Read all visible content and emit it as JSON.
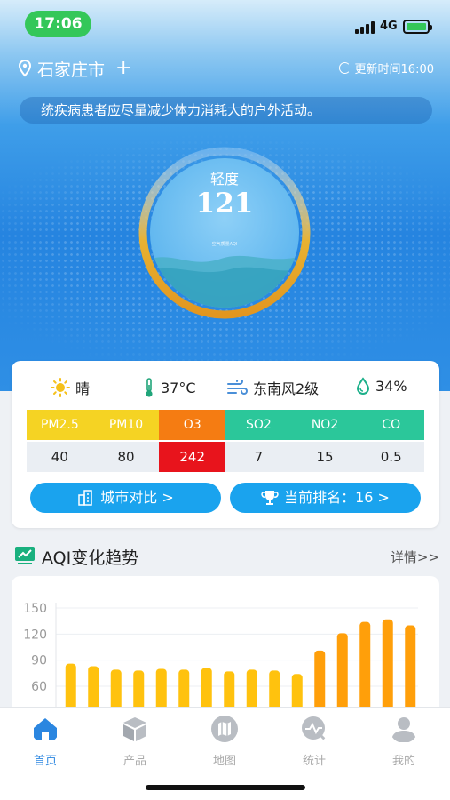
{
  "status_bar": {
    "time": "17:06",
    "network": "4G",
    "time_color": "#34c759"
  },
  "header": {
    "city": "石家庄市",
    "add_label": "+",
    "update_time": "更新时间16:00"
  },
  "advice": "统疾病患者应尽量减少体力消耗大的户外活动。",
  "aqi": {
    "level": "轻度",
    "value": "121",
    "sublabel": "空气质量AQI",
    "ring_color": "#e3a12c"
  },
  "weather": {
    "condition": "晴",
    "temperature": "37°C",
    "wind": "东南风2级",
    "humidity": "34%"
  },
  "pollutants": {
    "headers": [
      "PM2.5",
      "PM10",
      "O3",
      "SO2",
      "NO2",
      "CO"
    ],
    "values": [
      "40",
      "80",
      "242",
      "7",
      "15",
      "0.5"
    ],
    "header_colors": [
      "#f5d323",
      "#f5d323",
      "#f57c12",
      "#2bc79a",
      "#2bc79a",
      "#2bc79a"
    ],
    "value_highlight": {
      "index": 2,
      "color": "#e8141c"
    }
  },
  "buttons": {
    "city_compare": "城市对比 >",
    "ranking": "当前排名：16 >"
  },
  "trend": {
    "title": "AQI变化趋势",
    "more": "详情>>"
  },
  "chart_data": {
    "type": "bar",
    "title": "",
    "xlabel": "",
    "ylabel": "",
    "y_ticks": [
      150,
      120,
      90,
      60
    ],
    "ylim": [
      30,
      150
    ],
    "grid": true,
    "values": [
      86,
      83,
      79,
      78,
      80,
      79,
      81,
      77,
      79,
      78,
      74,
      101,
      121,
      134,
      137,
      130
    ],
    "colors": [
      "#ffc20e",
      "#ffc20e",
      "#ffc20e",
      "#ffc20e",
      "#ffc20e",
      "#ffc20e",
      "#ffc20e",
      "#ffc20e",
      "#ffc20e",
      "#ffc20e",
      "#ffc20e",
      "#ff9f0a",
      "#ff9f0a",
      "#ff9f0a",
      "#ff9f0a",
      "#ff9f0a"
    ]
  },
  "tabs": [
    {
      "label": "首页",
      "icon": "home-icon",
      "active": true
    },
    {
      "label": "产品",
      "icon": "box-icon",
      "active": false
    },
    {
      "label": "地图",
      "icon": "map-icon",
      "active": false
    },
    {
      "label": "统计",
      "icon": "stats-icon",
      "active": false
    },
    {
      "label": "我的",
      "icon": "profile-icon",
      "active": false
    }
  ]
}
